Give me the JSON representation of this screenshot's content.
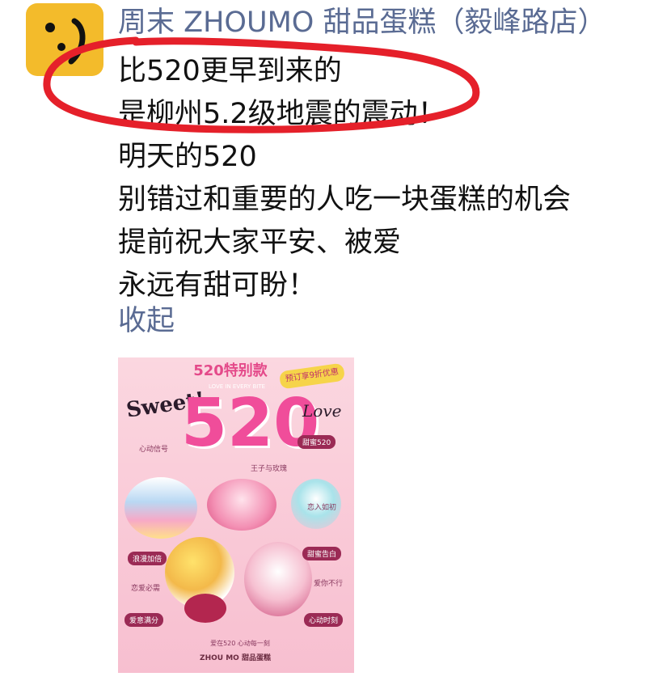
{
  "author": {
    "name": "周末 ZHOUMO 甜品蛋糕（毅峰路店）"
  },
  "post": {
    "lines": [
      "比520更早到来的",
      "是柳州5.2级地震的震动！",
      "明天的520",
      "别错过和重要的人吃一块蛋糕的机会",
      "提前祝大家平安、被爱",
      "永远有甜可盼！"
    ],
    "collapse_label": "收起"
  },
  "poster": {
    "title": "520特别款",
    "badge": "预订享9折优惠",
    "subtitle": "LOVE IN EVERY BITE",
    "big_number": "520",
    "sweet": "Sweet!",
    "love": "Love",
    "tags": {
      "t1": "心动信号",
      "t2": "甜蜜520",
      "t3": "王子与玫瑰",
      "t4": "恋入如初",
      "t5": "浪漫加倍",
      "t6": "甜蜜告白",
      "t7": "恋爱必需",
      "t8": "爱你不行",
      "t9": "爱意满分",
      "t10": "心动时刻"
    },
    "footer_slogan": "爱在520 心动每一刻",
    "footer_brand": "ZHOU MO 甜品蛋糕"
  },
  "colors": {
    "author_blue": "#5a6b93",
    "avatar_yellow": "#f3bb2b",
    "highlight_red": "#e5202a",
    "poster_pink": "#f04d9a"
  }
}
